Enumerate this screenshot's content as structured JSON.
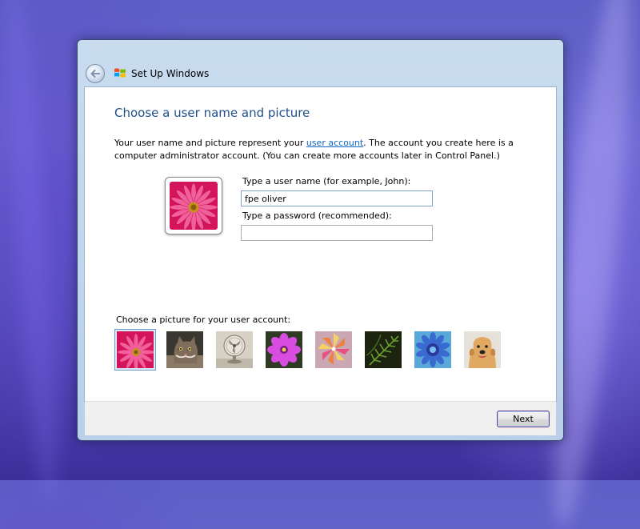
{
  "window": {
    "title": "Set Up Windows"
  },
  "page": {
    "heading": "Choose a user name and picture",
    "desc_before_link": "Your user name and picture represent your ",
    "desc_link": "user account",
    "desc_after_link": ". The account you create here is a computer administrator account. (You can create more accounts later in Control Panel.)"
  },
  "form": {
    "username_label": "Type a user name (for example, John):",
    "username_value": "fpe oliver",
    "password_label": "Type a password (recommended):",
    "password_value": ""
  },
  "pictures": {
    "label": "Choose a picture for your user account:",
    "items": [
      {
        "icon": "pink-daisy-icon",
        "selected": true
      },
      {
        "icon": "kitten-icon",
        "selected": false
      },
      {
        "icon": "fan-icon",
        "selected": false
      },
      {
        "icon": "purple-flower-icon",
        "selected": false
      },
      {
        "icon": "pinwheel-icon",
        "selected": false
      },
      {
        "icon": "fern-icon",
        "selected": false
      },
      {
        "icon": "blue-flower-icon",
        "selected": false
      },
      {
        "icon": "golden-retriever-icon",
        "selected": false
      }
    ]
  },
  "footer": {
    "next_label": "Next"
  },
  "colors": {
    "heading": "#1f4f8a",
    "link": "#1466c4",
    "selection": "#6d9bd1"
  }
}
